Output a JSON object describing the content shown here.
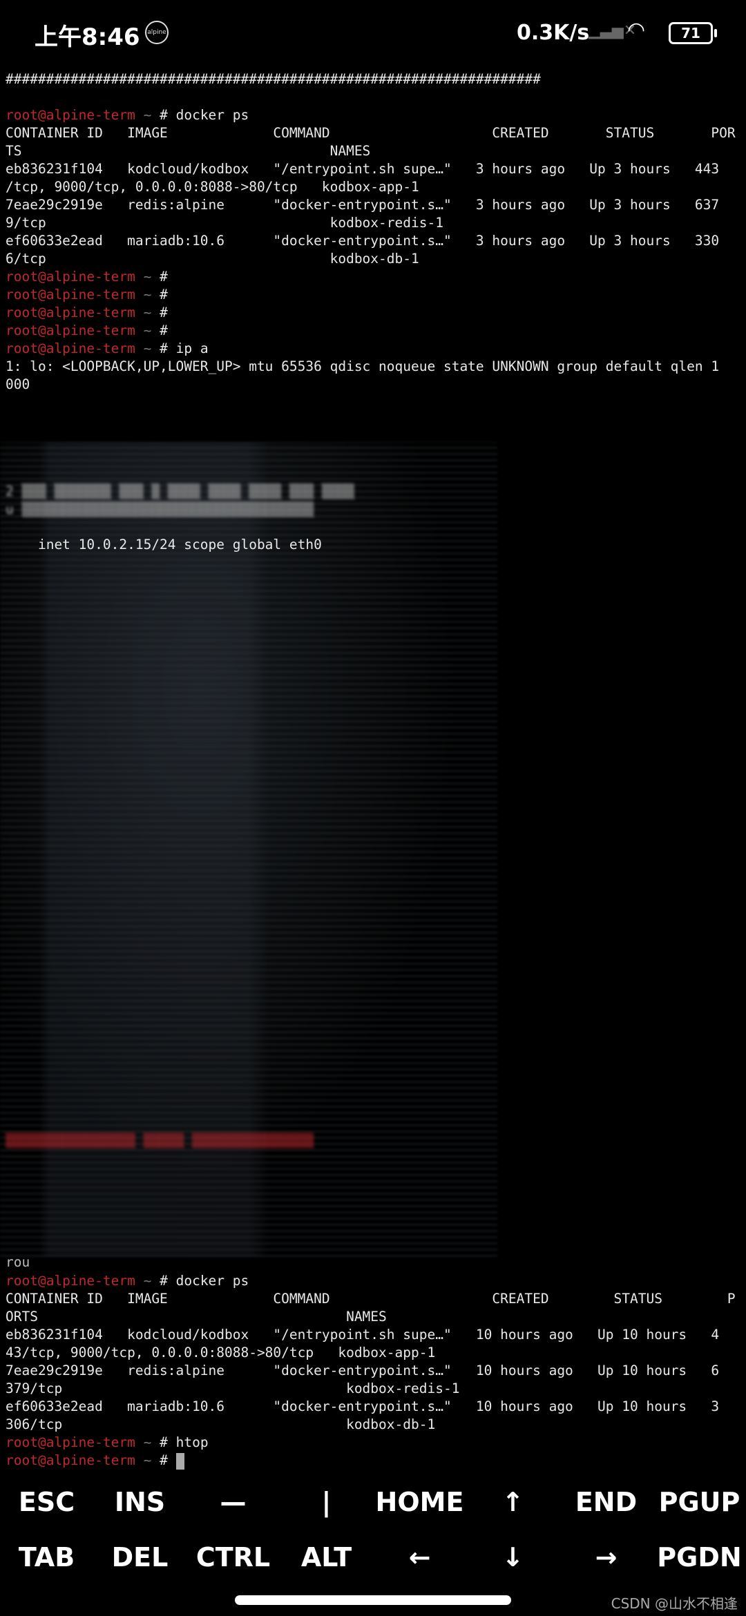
{
  "status_bar": {
    "time": "上午8:46",
    "app_icon": "alpine",
    "net_speed": "0.3K/s",
    "battery": "71",
    "signal_icon": "signal-no-service-icon",
    "wifi_icon": "wifi-icon"
  },
  "prompt": "root@alpine-term",
  "tilde": "~",
  "hash": "#",
  "terminal_top": [
    {
      "text": "##################################################################"
    },
    {
      "text": ""
    },
    {
      "prompt": true,
      "cmd": "docker ps"
    },
    {
      "text": "CONTAINER ID   IMAGE             COMMAND                    CREATED       STATUS       POR"
    },
    {
      "text": "TS                                      NAMES"
    },
    {
      "text": "eb836231f104   kodcloud/kodbox   \"/entrypoint.sh supe…\"   3 hours ago   Up 3 hours   443"
    },
    {
      "text": "/tcp, 9000/tcp, 0.0.0.0:8088->80/tcp   kodbox-app-1"
    },
    {
      "text": "7eae29c2919e   redis:alpine      \"docker-entrypoint.s…\"   3 hours ago   Up 3 hours   637"
    },
    {
      "text": "9/tcp                                   kodbox-redis-1"
    },
    {
      "text": "ef60633e2ead   mariadb:10.6      \"docker-entrypoint.s…\"   3 hours ago   Up 3 hours   330"
    },
    {
      "text": "6/tcp                                   kodbox-db-1"
    },
    {
      "prompt": true,
      "cmd": ""
    },
    {
      "prompt": true,
      "cmd": ""
    },
    {
      "prompt": true,
      "cmd": ""
    },
    {
      "prompt": true,
      "cmd": ""
    },
    {
      "prompt": true,
      "cmd": "ip a"
    },
    {
      "text": "1: lo: <LOOPBACK,UP,LOWER_UP> mtu 65536 qdisc noqueue state UNKNOWN group default qlen 1"
    },
    {
      "text": "000"
    }
  ],
  "inet_line": "    inet 10.0.2.15/24 scope global eth0",
  "glitch_fragment": "rou",
  "terminal_bottom": [
    {
      "prompt": true,
      "cmd": "docker ps"
    },
    {
      "text": "CONTAINER ID   IMAGE             COMMAND                    CREATED        STATUS        P"
    },
    {
      "text": "ORTS                                      NAMES"
    },
    {
      "text": "eb836231f104   kodcloud/kodbox   \"/entrypoint.sh supe…\"   10 hours ago   Up 10 hours   4"
    },
    {
      "text": "43/tcp, 9000/tcp, 0.0.0.0:8088->80/tcp   kodbox-app-1"
    },
    {
      "text": "7eae29c2919e   redis:alpine      \"docker-entrypoint.s…\"   10 hours ago   Up 10 hours   6"
    },
    {
      "text": "379/tcp                                   kodbox-redis-1"
    },
    {
      "text": "ef60633e2ead   mariadb:10.6      \"docker-entrypoint.s…\"   10 hours ago   Up 10 hours   3"
    },
    {
      "text": "306/tcp                                   kodbox-db-1"
    },
    {
      "prompt": true,
      "cmd": "htop"
    },
    {
      "prompt": true,
      "cmd": "",
      "cursor": true
    }
  ],
  "extra_keys": {
    "row1": [
      "ESC",
      "INS",
      "—",
      "|",
      "HOME",
      "↑",
      "END",
      "PGUP"
    ],
    "row2": [
      "TAB",
      "DEL",
      "CTRL",
      "ALT",
      "←",
      "↓",
      "→",
      "PGDN"
    ]
  },
  "watermark": "CSDN @山水不相逢",
  "colors": {
    "prompt": "#c0282b",
    "background": "#000000",
    "text": "#e8e8e8"
  }
}
